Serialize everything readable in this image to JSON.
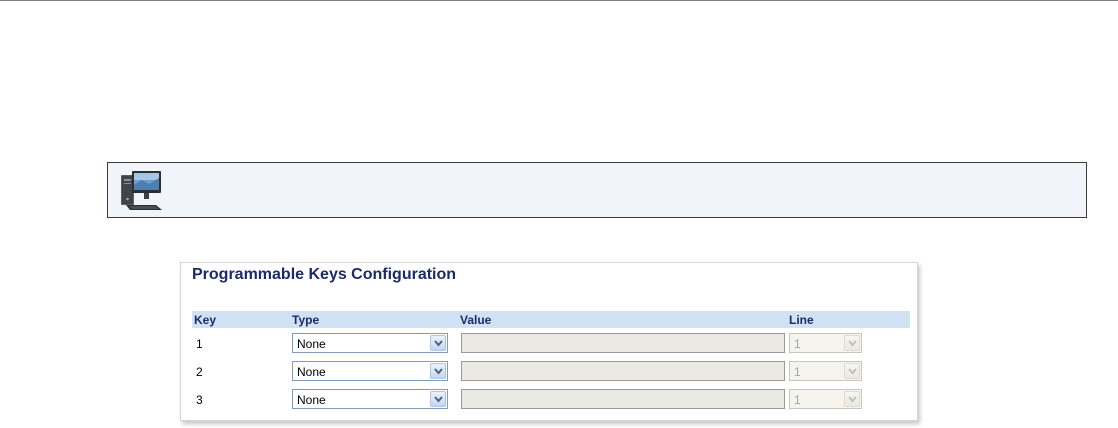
{
  "panel": {
    "title": "Programmable Keys Configuration",
    "columns": {
      "key": "Key",
      "type": "Type",
      "value": "Value",
      "line": "Line"
    },
    "rows": [
      {
        "key": "1",
        "type": "None",
        "value": "",
        "line": "1"
      },
      {
        "key": "2",
        "type": "None",
        "value": "",
        "line": "1"
      },
      {
        "key": "3",
        "type": "None",
        "value": "",
        "line": "1"
      }
    ]
  },
  "icons": {
    "note": "desktop-computer-icon",
    "dropdown": "chevron-down-icon"
  },
  "colors": {
    "title": "#1b2a6b",
    "header_bg": "#d0e2f4",
    "note_bg": "#f1f5fa",
    "disabled_field": "#ebe9e4"
  }
}
